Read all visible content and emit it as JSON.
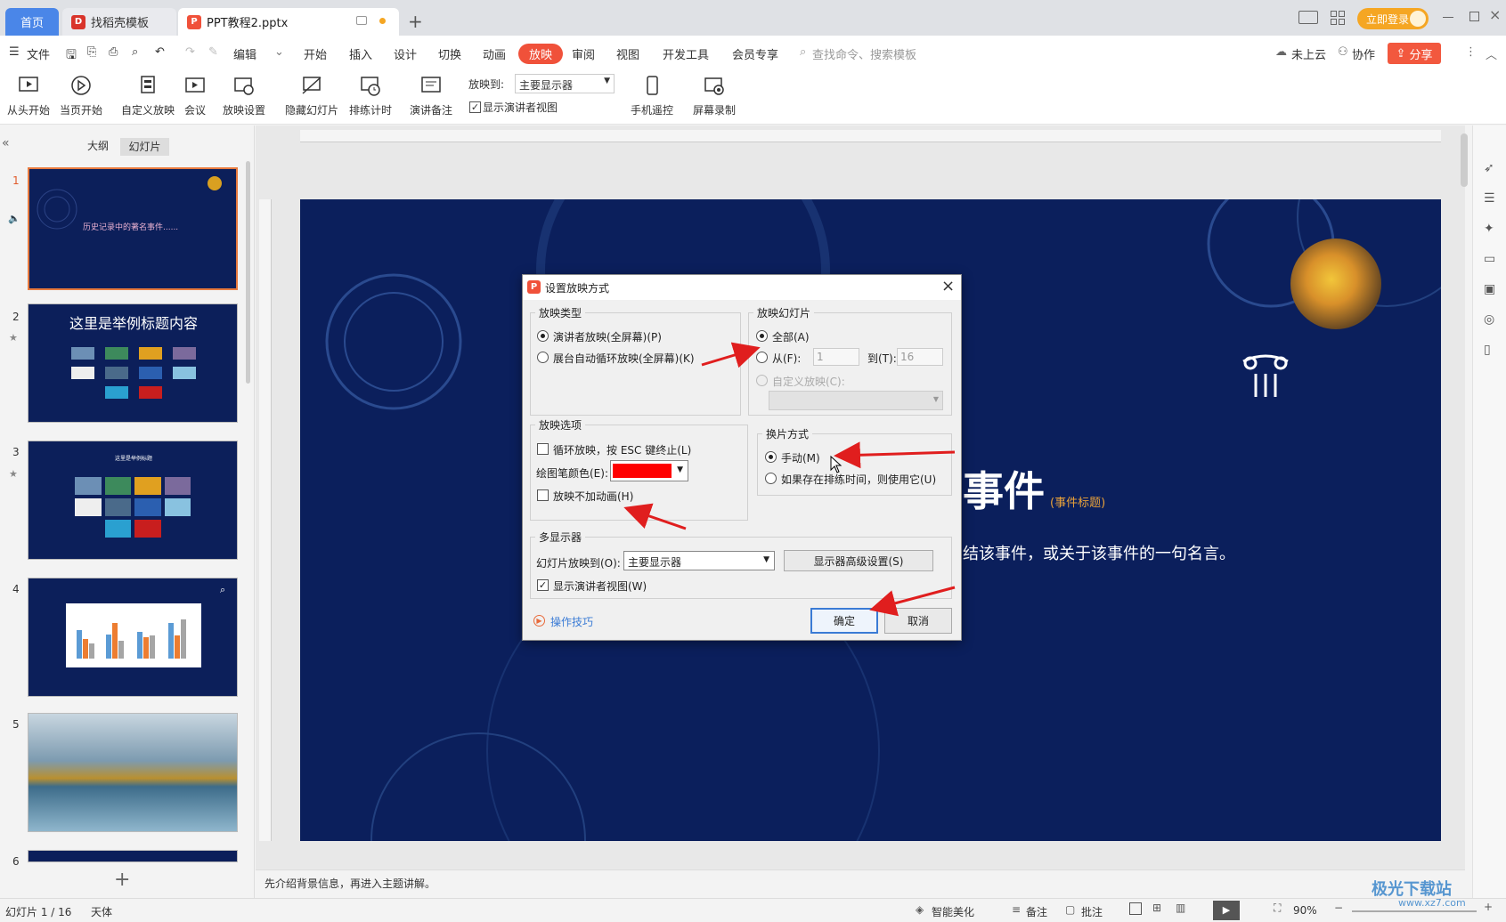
{
  "tabs": {
    "home": "首页",
    "template": "找稻壳模板",
    "document": "PPT教程2.pptx"
  },
  "topbar": {
    "login": "立即登录"
  },
  "menu": {
    "file": "文件",
    "edit": "编辑",
    "start": "开始",
    "insert": "插入",
    "design": "设计",
    "transition": "切换",
    "animation": "动画",
    "slideshow": "放映",
    "review": "审阅",
    "view": "视图",
    "developer": "开发工具",
    "member": "会员专享",
    "search_placeholder": "查找命令、搜索模板",
    "cloud": "未上云",
    "collab": "协作",
    "share": "分享"
  },
  "ribbon": {
    "from_start": "从头开始",
    "from_current": "当页开始",
    "custom": "自定义放映",
    "meeting": "会议",
    "setup": "放映设置",
    "hide": "隐藏幻灯片",
    "rehearse": "排练计时",
    "notes": "演讲备注",
    "show_on_label": "放映到:",
    "show_on_value": "主要显示器",
    "presenter_view": "显示演讲者视图",
    "phone_remote": "手机遥控",
    "screen_record": "屏幕录制"
  },
  "leftpanel": {
    "tab_outline": "大纲",
    "tab_slides": "幻灯片",
    "slides": [
      {
        "num": "1",
        "title": "历史记录中的著名事件......"
      },
      {
        "num": "2",
        "title": "这里是举例标题内容"
      },
      {
        "num": "3",
        "title": "这里是举例标题"
      },
      {
        "num": "4",
        "title": ""
      },
      {
        "num": "5",
        "title": ""
      },
      {
        "num": "6",
        "title": ""
      }
    ],
    "add": "+"
  },
  "slide": {
    "title_fragment": "事件",
    "title_tag": "(事件标题)",
    "subtitle_fragment": "结该事件，或关于该事件的一句名言。"
  },
  "dialog": {
    "title": "设置放映方式",
    "show_type": {
      "legend": "放映类型",
      "presenter": "演讲者放映(全屏幕)(P)",
      "kiosk": "展台自动循环放映(全屏幕)(K)"
    },
    "show_slides": {
      "legend": "放映幻灯片",
      "all": "全部(A)",
      "from": "从(F):",
      "from_value": "1",
      "to": "到(T):",
      "to_value": "16",
      "custom": "自定义放映(C):"
    },
    "options": {
      "legend": "放映选项",
      "loop": "循环放映，按 ESC 键终止(L)",
      "pen_color": "绘图笔颜色(E):",
      "pen_color_value": "#ff0000",
      "no_animation": "放映不加动画(H)"
    },
    "advance": {
      "legend": "换片方式",
      "manual": "手动(M)",
      "timings": "如果存在排练时间，则使用它(U)"
    },
    "multi": {
      "legend": "多显示器",
      "show_on": "幻灯片放映到(O):",
      "monitor": "主要显示器",
      "advanced": "显示器高级设置(S)",
      "presenter_view": "显示演讲者视图(W)"
    },
    "tips": "操作技巧",
    "ok": "确定",
    "cancel": "取消"
  },
  "notes": "先介绍背景信息，再进入主题讲解。",
  "status": {
    "slide": "幻灯片 1 / 16",
    "theme": "天体",
    "beautify": "智能美化",
    "notes": "备注",
    "comment": "批注",
    "zoom": "90%"
  },
  "watermark": {
    "name": "极光下载站",
    "url": "www.xz7.com"
  },
  "colors": {
    "accent": "#f0513a",
    "slide_bg": "#0b1f5c",
    "home_tab": "#4a86e8",
    "annotation_arrow": "#e01e1e"
  }
}
